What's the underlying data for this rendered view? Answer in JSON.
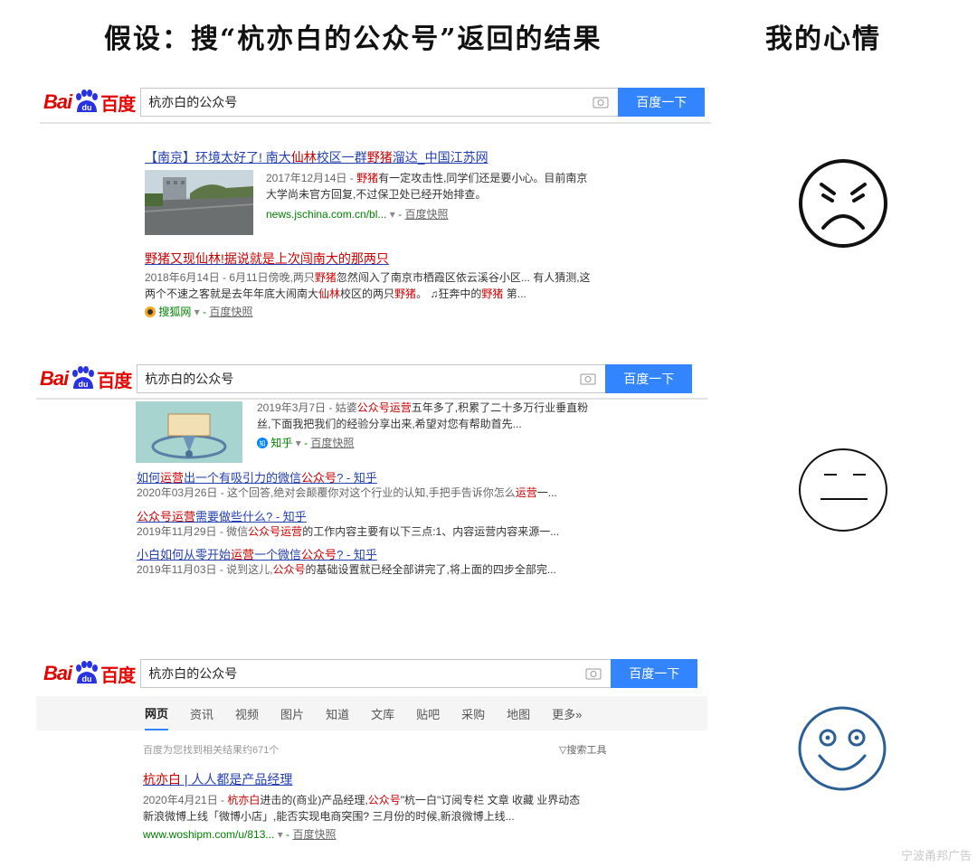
{
  "header": {
    "title": "假设：搜“杭亦白的公众号”返回的结果",
    "mood": "我的心情"
  },
  "logo": {
    "bai": "Bai",
    "du": "百度",
    "paw_glyph": "du"
  },
  "panels": [
    {
      "query": "杭亦白的公众号",
      "button": "百度一下",
      "results": [
        {
          "title_parts": [
            "【南京】环境太好了! 南大",
            "仙林",
            "校区一群",
            "野猪",
            "溜达_中国江苏网"
          ],
          "line1_parts": [
            "2017年12月14日 - ",
            "野猪",
            "有一定攻击性,同学们还是要小心。目前南京"
          ],
          "line2": "大学尚未官方回复,不过保卫处已经开始排查。",
          "url": "news.jschina.com.cn/bl...",
          "snap": "百度快照"
        },
        {
          "title_parts": [
            "野猪",
            "又现",
            "仙林",
            "!据说就是上次闯南大的那两只"
          ],
          "line1_parts": [
            "2018年6月14日 - 6月11日傍晚,两只",
            "野猪",
            "忽然闯入了南京市栖霞区依云溪谷小区... 有人猜测,这"
          ],
          "line2_parts": [
            "两个不速之客就是去年年底大闹南大",
            "仙林",
            "校区的两只",
            "野猪",
            "。 ♫狂奔中的",
            "野猪",
            " 第..."
          ],
          "source": "搜狐网",
          "snap": "百度快照"
        }
      ]
    },
    {
      "query": "杭亦白的公众号",
      "button": "百度一下",
      "top_result": {
        "line1_parts": [
          "2019年3月7日 - 姑婆",
          "公众号运营",
          "五年多了,积累了二十多万行业垂直粉"
        ],
        "line2": "丝,下面我把我们的经验分享出来,希望对您有帮助首先...",
        "source": "知乎",
        "snap": "百度快照"
      },
      "results": [
        {
          "title_parts": [
            "如何",
            "运营",
            "出一个有吸引力的微信",
            "公众号",
            "? - 知乎"
          ],
          "desc_parts": [
            "2020年03月26日 - 这个回答,绝对会颠覆你对这个行业的认知,手把手告诉你怎么",
            "运营",
            "一..."
          ]
        },
        {
          "title_parts": [
            "公众号运营",
            "需要做些什么? - 知乎"
          ],
          "desc_parts": [
            "2019年11月29日 - 微信",
            "公众号运营",
            "的工作内容主要有以下三点:1、内容运营内容来源一..."
          ]
        },
        {
          "title_parts": [
            "小白如何从零开始",
            "运营",
            "一个微信",
            "公众号",
            "? - 知乎"
          ],
          "desc_parts": [
            "2019年11月03日 - 说到这儿,",
            "公众号",
            "的基础设置就已经全部讲完了,将上面的四步全部完..."
          ]
        }
      ]
    },
    {
      "query": "杭亦白的公众号",
      "button": "百度一下",
      "tabs": [
        "网页",
        "资讯",
        "视频",
        "图片",
        "知道",
        "文库",
        "贴吧",
        "采购",
        "地图",
        "更多»"
      ],
      "result_count": "百度为您找到相关结果约671个",
      "search_tools": "搜索工具",
      "result": {
        "title_parts": [
          "杭亦白",
          " | 人人都是产品经理"
        ],
        "line1_parts": [
          "2020年4月21日 - ",
          "杭亦白",
          "进击的(商业)产品经理,",
          "公众号",
          "\"杭一白\"订阅专栏 文章 收藏 业界动态"
        ],
        "line2": "新浪微博上线「微博小店」,能否实现电商突围? 三月份的时候,新浪微博上线...",
        "url": "www.woshipm.com/u/813...",
        "snap": "百度快照"
      }
    }
  ],
  "faces": [
    "angry-face",
    "neutral-face",
    "happy-face"
  ],
  "colors": {
    "accent": "#3385ff",
    "highlight": "#c00000",
    "link": "#2440b3",
    "happy_face": "#2a5f96"
  },
  "watermark": "宁波甬邦广告"
}
